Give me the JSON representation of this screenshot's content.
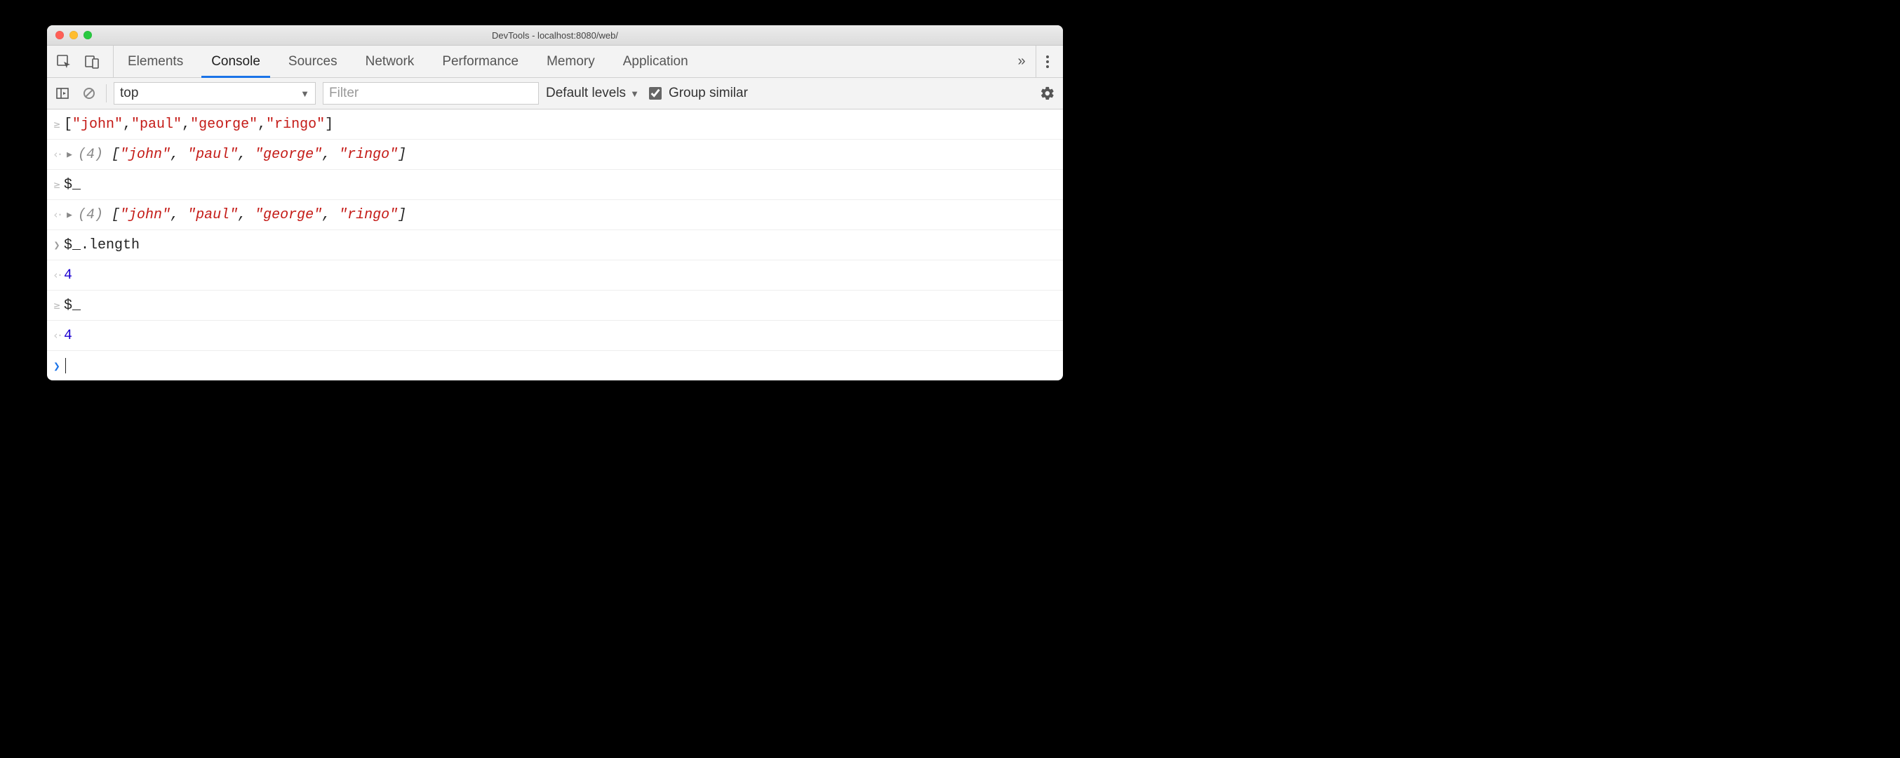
{
  "window": {
    "title": "DevTools - localhost:8080/web/"
  },
  "tabs": {
    "items": [
      "Elements",
      "Console",
      "Sources",
      "Network",
      "Performance",
      "Memory",
      "Application"
    ],
    "active_index": 1,
    "overflow_glyph": "»"
  },
  "console_toolbar": {
    "context_label": "top",
    "filter_placeholder": "Filter",
    "levels_label": "Default levels",
    "group_similar_label": "Group similar",
    "group_similar_checked": true
  },
  "console": {
    "rows": [
      {
        "kind": "input-eager",
        "segments": [
          {
            "t": "[",
            "c": "s-pun"
          },
          {
            "t": "\"john\"",
            "c": "s-str"
          },
          {
            "t": ",",
            "c": "s-pun"
          },
          {
            "t": "\"paul\"",
            "c": "s-str"
          },
          {
            "t": ",",
            "c": "s-pun"
          },
          {
            "t": "\"george\"",
            "c": "s-str"
          },
          {
            "t": ",",
            "c": "s-pun"
          },
          {
            "t": "\"ringo\"",
            "c": "s-str"
          },
          {
            "t": "]",
            "c": "s-pun"
          }
        ]
      },
      {
        "kind": "output",
        "expandable": true,
        "segments": [
          {
            "t": "(4) ",
            "c": "s-dim"
          },
          {
            "t": "[",
            "c": "s-it"
          },
          {
            "t": "\"john\"",
            "c": "s-str s-it"
          },
          {
            "t": ", ",
            "c": "s-it"
          },
          {
            "t": "\"paul\"",
            "c": "s-str s-it"
          },
          {
            "t": ", ",
            "c": "s-it"
          },
          {
            "t": "\"george\"",
            "c": "s-str s-it"
          },
          {
            "t": ", ",
            "c": "s-it"
          },
          {
            "t": "\"ringo\"",
            "c": "s-str s-it"
          },
          {
            "t": "]",
            "c": "s-it"
          }
        ]
      },
      {
        "kind": "input-eager",
        "segments": [
          {
            "t": "$_",
            "c": "s-code"
          }
        ]
      },
      {
        "kind": "output",
        "expandable": true,
        "segments": [
          {
            "t": "(4) ",
            "c": "s-dim"
          },
          {
            "t": "[",
            "c": "s-it"
          },
          {
            "t": "\"john\"",
            "c": "s-str s-it"
          },
          {
            "t": ", ",
            "c": "s-it"
          },
          {
            "t": "\"paul\"",
            "c": "s-str s-it"
          },
          {
            "t": ", ",
            "c": "s-it"
          },
          {
            "t": "\"george\"",
            "c": "s-str s-it"
          },
          {
            "t": ", ",
            "c": "s-it"
          },
          {
            "t": "\"ringo\"",
            "c": "s-str s-it"
          },
          {
            "t": "]",
            "c": "s-it"
          }
        ]
      },
      {
        "kind": "input",
        "segments": [
          {
            "t": "$_.length",
            "c": "s-code"
          }
        ]
      },
      {
        "kind": "output",
        "segments": [
          {
            "t": "4",
            "c": "s-num"
          }
        ]
      },
      {
        "kind": "input-eager",
        "segments": [
          {
            "t": "$_",
            "c": "s-code"
          }
        ]
      },
      {
        "kind": "output",
        "segments": [
          {
            "t": "4",
            "c": "s-num"
          }
        ]
      },
      {
        "kind": "prompt"
      }
    ]
  }
}
